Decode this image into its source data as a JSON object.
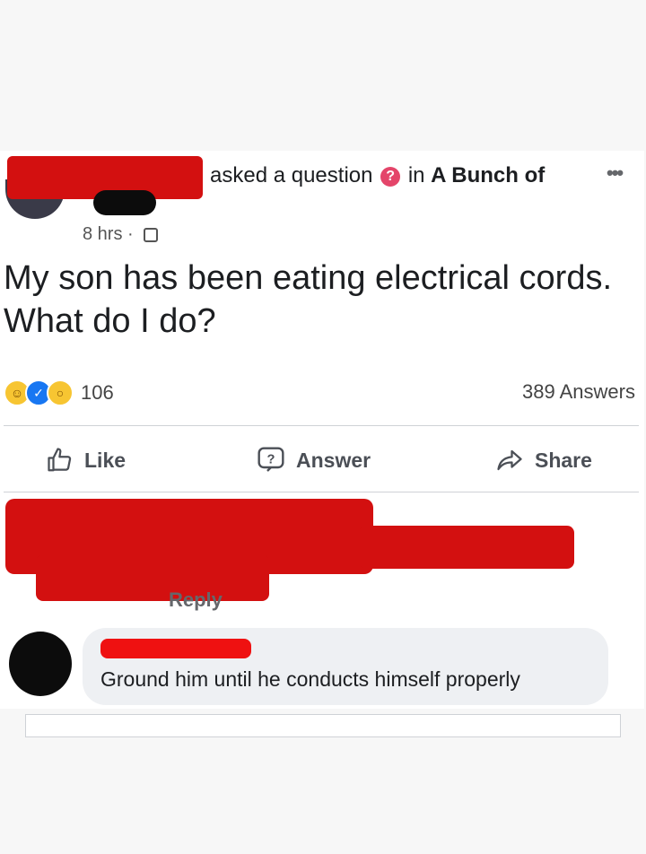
{
  "post": {
    "action_text": "asked a question",
    "question_badge_glyph": "?",
    "group_prefix": "in",
    "group_name": "A Bunch of",
    "more_glyph": "•••",
    "timestamp": "8 hrs",
    "meta_separator": "·",
    "visibility_icon": "group-icon",
    "question_text": "My son has been eating electrical cords. What do I do?",
    "reactions": {
      "icons": [
        "haha-reaction-icon",
        "like-reaction-icon",
        "wow-reaction-icon"
      ],
      "count": "106"
    },
    "answers_count": "389 Answers"
  },
  "actions": {
    "like": "Like",
    "answer": "Answer",
    "share": "Share"
  },
  "first_comment": {
    "reply_label": "Reply"
  },
  "comment": {
    "text": "Ground him until he conducts himself properly"
  },
  "colors": {
    "redaction": "#d31010",
    "question_badge": "#e4456a",
    "like_blue": "#1877f2",
    "bubble_bg": "#eef0f3"
  }
}
